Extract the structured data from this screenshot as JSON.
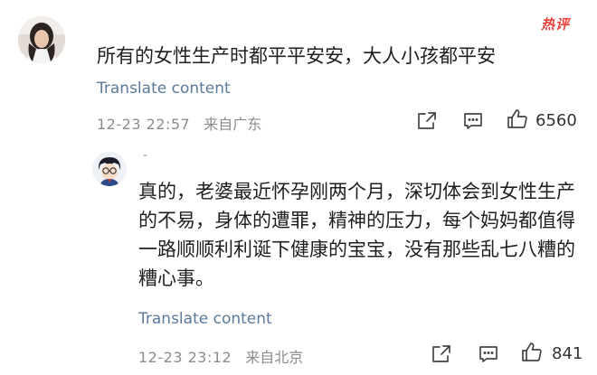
{
  "comment": {
    "badge": "热评",
    "text": "所有的女性生产时都平平安安，大人小孩都平安",
    "translate": "Translate content",
    "time": "12-23 22:57",
    "location": "来自广东",
    "likes": "6560"
  },
  "reply": {
    "username_hint": "-",
    "text": "真的，老婆最近怀孕刚两个月，深切体会到女性生产的不易，身体的遭罪，精神的压力，每个妈妈都值得一路顺顺利利诞下健康的宝宝，没有那些乱七八糟的糟心事。",
    "translate": "Translate content",
    "time": "12-23 23:12",
    "location": "来自北京",
    "likes": "841"
  },
  "colors": {
    "link": "#5a7a9c",
    "meta": "#8c8c8c",
    "hot_badge": "#e8413a"
  },
  "icons": [
    "share-icon",
    "comment-icon",
    "thumbs-up-icon"
  ]
}
